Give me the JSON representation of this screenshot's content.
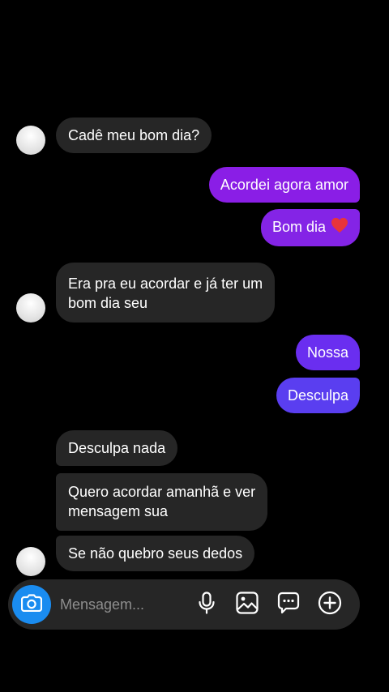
{
  "messages": [
    {
      "id": "m1",
      "side": "in",
      "text": "Cadê meu bom dia?"
    },
    {
      "id": "m2",
      "side": "out",
      "text": "Acordei agora amor",
      "color": "#8a1ee6"
    },
    {
      "id": "m3",
      "side": "out",
      "text": "Bom dia",
      "emoji": "heart",
      "color": "#8424e6"
    },
    {
      "id": "m4",
      "side": "in",
      "lines": [
        "Era pra eu acordar e já ter um",
        "bom dia seu"
      ]
    },
    {
      "id": "m5",
      "side": "out",
      "text": "Nossa",
      "color": "#6a2ef0"
    },
    {
      "id": "m6",
      "side": "out",
      "text": "Desculpa",
      "color": "#5a3ef0"
    },
    {
      "id": "m7",
      "side": "in",
      "text": "Desculpa nada"
    },
    {
      "id": "m8",
      "side": "in",
      "lines": [
        "Quero acordar amanhã e ver",
        "mensagem sua"
      ]
    },
    {
      "id": "m9",
      "side": "in",
      "text": "Se não quebro seus dedos"
    }
  ],
  "composer": {
    "placeholder": "Mensagem...",
    "icons": [
      "camera-icon",
      "microphone-icon",
      "gallery-icon",
      "sticker-icon",
      "add-icon"
    ],
    "camera_color": "#1a8cf0"
  }
}
